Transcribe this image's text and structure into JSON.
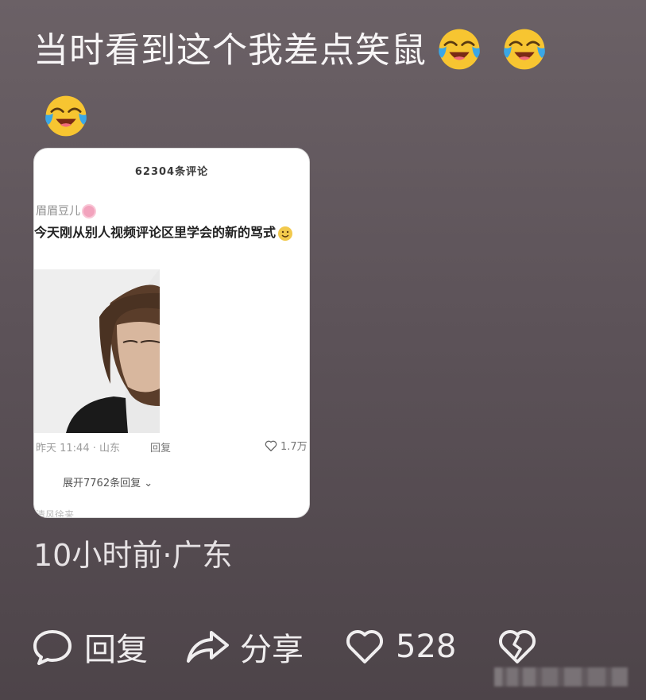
{
  "post": {
    "text": "当时看到这个我差点笑鼠",
    "emojis": [
      "laugh-cry-emoji",
      "laugh-cry-emoji",
      "laugh-cry-emoji"
    ],
    "time_location": "10小时前·广东"
  },
  "embedded_screenshot": {
    "header": "62304条评论",
    "username": "眉眉豆儿",
    "comment": "今天刚从别人视频评论区里学会的新的骂式",
    "meta": "昨天 11:44 · 山东",
    "reply_label": "回复",
    "like_count": "1.7万",
    "expand_label": "展开7762条回复",
    "faded_text": "清风徐来"
  },
  "actions": {
    "reply_label": "回复",
    "share_label": "分享",
    "like_count": "528",
    "dislike_icon": "broken-heart-icon"
  },
  "colors": {
    "background": "#5d5359",
    "text": "#f4f2f3",
    "emoji_yellow": "#f7c531",
    "tear_blue": "#3aa7e6"
  }
}
